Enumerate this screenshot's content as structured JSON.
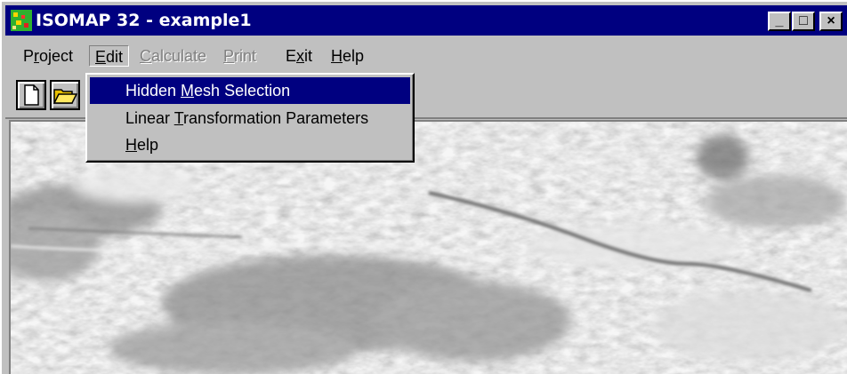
{
  "window": {
    "title": "ISOMAP 32 - example1",
    "controls": {
      "minimize": "_",
      "maximize": "□",
      "close": "×"
    }
  },
  "menubar": {
    "items": [
      {
        "label_pre": "P",
        "label_ul": "r",
        "label_post": "oject",
        "enabled": true
      },
      {
        "label_pre": "",
        "label_ul": "E",
        "label_post": "dit",
        "enabled": true,
        "open": true
      },
      {
        "label_pre": "",
        "label_ul": "C",
        "label_post": "alculate",
        "enabled": false
      },
      {
        "label_pre": "",
        "label_ul": "P",
        "label_post": "rint",
        "enabled": false
      },
      {
        "label_pre": "E",
        "label_ul": "x",
        "label_post": "it",
        "enabled": true
      },
      {
        "label_pre": "",
        "label_ul": "H",
        "label_post": "elp",
        "enabled": true
      }
    ]
  },
  "toolbar": {
    "buttons": [
      {
        "icon": "new-document-icon"
      },
      {
        "icon": "open-folder-icon"
      }
    ]
  },
  "edit_menu": {
    "items": [
      {
        "label_pre": "Hidden ",
        "label_ul": "M",
        "label_post": "esh Selection",
        "highlighted": true
      },
      {
        "label_pre": "Linear ",
        "label_ul": "T",
        "label_post": "ransformation Parameters",
        "highlighted": false
      },
      {
        "label_pre": "",
        "label_ul": "H",
        "label_post": "elp",
        "highlighted": false
      }
    ]
  },
  "colors": {
    "title_bar": "#000080",
    "menu_highlight": "#000080",
    "face": "#c0c0c0",
    "disabled_text": "#808080",
    "app_icon": "#2fb02f"
  },
  "canvas": {
    "content": "grayscale-terrain-image"
  }
}
